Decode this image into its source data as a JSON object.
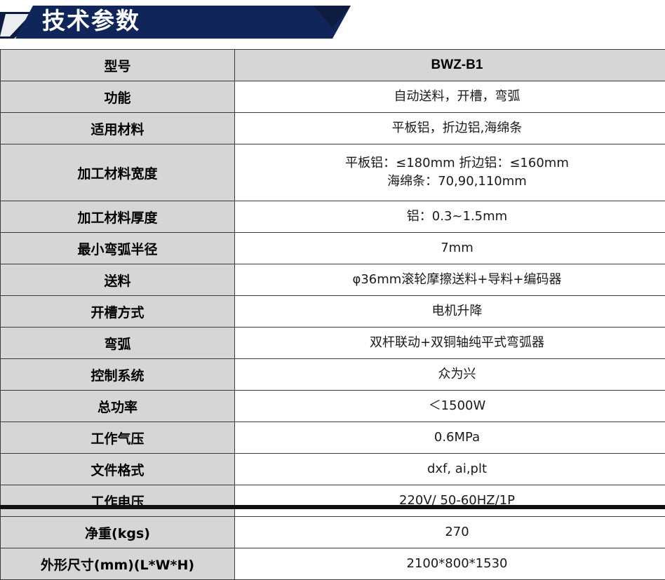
{
  "banner": {
    "title": "技术参数",
    "bg_color": "#10265a",
    "accent_dark": "#0d1c40",
    "text_color": "#ffffff"
  },
  "table": {
    "label_bg": "#d6d6d6",
    "value_bg": "#ffffff",
    "border_color": "#3a3a3a",
    "rows": [
      {
        "label": "型号",
        "value": "BWZ-B1",
        "header": true
      },
      {
        "label": "功能",
        "value": "自动送料，开槽，弯弧"
      },
      {
        "label": "适用材料",
        "value": "平板铝，折边铝,海绵条"
      },
      {
        "label": "加工材料宽度",
        "value": "平板铝：≤180mm 折边铝：≤160mm",
        "value2": "海绵条：70,90,110mm",
        "tall": true
      },
      {
        "label": "加工材料厚度",
        "value": "铝：0.3~1.5mm"
      },
      {
        "label": "最小弯弧半径",
        "value": "7mm"
      },
      {
        "label": "送料",
        "value": "φ36mm滚轮摩擦送料+导料+编码器"
      },
      {
        "label": "开槽方式",
        "value": "电机升降"
      },
      {
        "label": "弯弧",
        "value": "双杆联动+双铜轴纯平式弯弧器"
      },
      {
        "label": "控制系统",
        "value": "众为兴"
      },
      {
        "label": "总功率",
        "value": "＜1500W"
      },
      {
        "label": "工作气压",
        "value": "0.6MPa"
      },
      {
        "label": "文件格式",
        "value": "dxf, ai,plt"
      },
      {
        "label": "工作电压",
        "value": "220V/ 50-60HZ/1P"
      },
      {
        "label": "净重(kgs)",
        "value": "270"
      },
      {
        "label": "外形尺寸(mm)(L*W*H)",
        "value": "2100*800*1530"
      }
    ]
  }
}
